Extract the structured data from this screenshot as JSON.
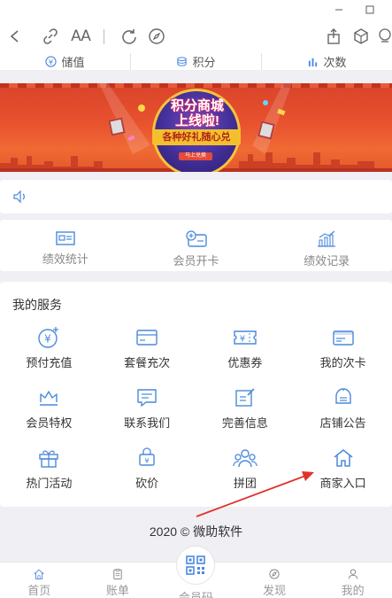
{
  "colors": {
    "accent": "#3f7bd8",
    "icon_blue": "#4a89dc",
    "muted": "#999999",
    "arrow": "#e0322b"
  },
  "window": {
    "min_icon": "minimize-icon",
    "max_icon": "maximize-icon"
  },
  "toolbar": {
    "icons": [
      "back-icon",
      "link-icon",
      "font-size-icon",
      "refresh-icon",
      "compass-icon",
      "share-icon",
      "cube-icon",
      "more-icon"
    ],
    "font_label": "AA"
  },
  "stats": [
    {
      "label": "储值",
      "icon": "yen-circle-icon"
    },
    {
      "label": "积分",
      "icon": "coins-icon"
    },
    {
      "label": "次数",
      "icon": "bar-chart-icon"
    }
  ],
  "banner": {
    "title_line1": "积分商城",
    "title_line2": "上线啦!",
    "subtitle": "各种好礼随心兑",
    "cta": "马上兑换"
  },
  "notice": {
    "icon": "speaker-icon",
    "text": ""
  },
  "quick": [
    {
      "label": "绩效统计",
      "icon": "id-card-icon"
    },
    {
      "label": "会员开卡",
      "icon": "add-card-icon"
    },
    {
      "label": "绩效记录",
      "icon": "chart-record-icon"
    }
  ],
  "services": {
    "title": "我的服务",
    "items": [
      {
        "label": "预付充值",
        "icon": "yen-plus-icon"
      },
      {
        "label": "套餐充次",
        "icon": "card-icon"
      },
      {
        "label": "优惠券",
        "icon": "coupon-icon"
      },
      {
        "label": "我的次卡",
        "icon": "member-card-icon"
      },
      {
        "label": "会员特权",
        "icon": "crown-icon"
      },
      {
        "label": "联系我们",
        "icon": "chat-icon"
      },
      {
        "label": "完善信息",
        "icon": "edit-icon"
      },
      {
        "label": "店铺公告",
        "icon": "announcement-icon"
      },
      {
        "label": "热门活动",
        "icon": "gift-icon"
      },
      {
        "label": "砍价",
        "icon": "bargain-icon"
      },
      {
        "label": "拼团",
        "icon": "group-icon"
      },
      {
        "label": "商家入口",
        "icon": "home-icon"
      }
    ]
  },
  "copyright": "2020 © 微助软件",
  "nav": [
    {
      "label": "首页",
      "icon": "home-nav-icon"
    },
    {
      "label": "账单",
      "icon": "bill-icon"
    },
    {
      "label": "会员码",
      "icon": "qr-code-icon"
    },
    {
      "label": "发现",
      "icon": "discover-icon"
    },
    {
      "label": "我的",
      "icon": "user-icon"
    }
  ]
}
